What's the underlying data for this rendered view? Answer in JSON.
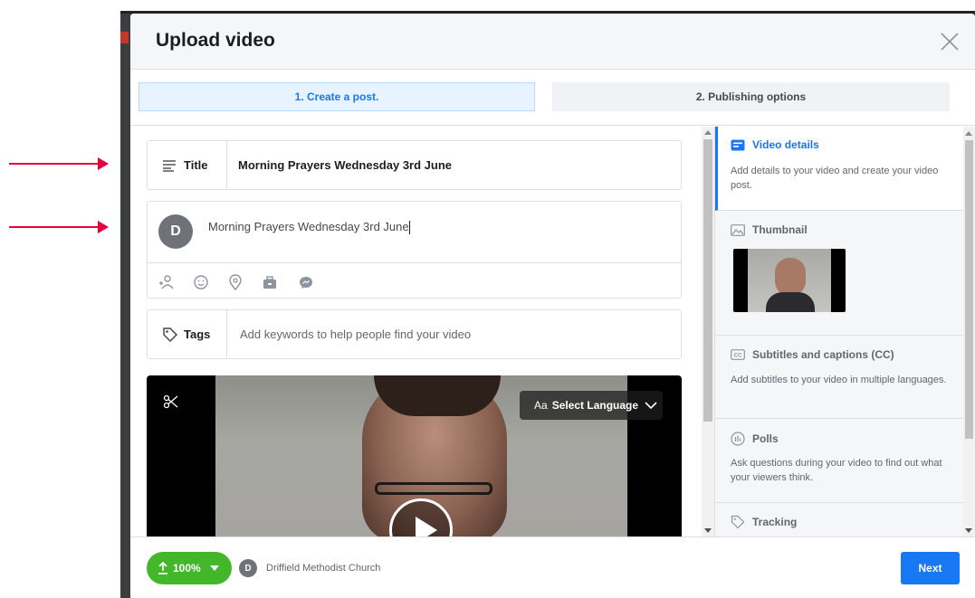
{
  "dialog": {
    "title": "Upload video",
    "close_icon": "close-icon"
  },
  "steps": [
    {
      "label": "1. Create a post.",
      "active": true
    },
    {
      "label": "2. Publishing options",
      "active": false
    }
  ],
  "title_field": {
    "icon": "title-lines-icon",
    "label": "Title",
    "value": "Morning Prayers Wednesday 3rd June"
  },
  "post": {
    "avatar_letter": "D",
    "text": "Morning Prayers Wednesday 3rd June",
    "tools": [
      "tag-people-icon",
      "feeling-icon",
      "location-icon",
      "briefcase-icon",
      "messenger-icon"
    ]
  },
  "tags_field": {
    "icon": "tag-icon",
    "label": "Tags",
    "placeholder": "Add keywords to help people find your video"
  },
  "video": {
    "aa": "Aa",
    "language_label": "Select Language",
    "scissors_icon": "scissors-icon",
    "play_icon": "play-icon"
  },
  "side_panel": {
    "video_details": {
      "title": "Video details",
      "description": "Add details to your video and create your video post."
    },
    "thumbnail": {
      "title": "Thumbnail"
    },
    "subtitles": {
      "title": "Subtitles and captions (CC)",
      "description": "Add subtitles to your video in multiple languages."
    },
    "polls": {
      "title": "Polls",
      "description": "Ask questions during your video to find out what your viewers think."
    },
    "tracking": {
      "title": "Tracking"
    }
  },
  "footer": {
    "upload_progress": "100%",
    "page_avatar_letter": "D",
    "page_name": "Driffield Methodist Church",
    "next_label": "Next"
  },
  "colors": {
    "accent": "#1877f2",
    "upload_green": "#42b72a",
    "annotation_arrow": "#e4003b"
  }
}
